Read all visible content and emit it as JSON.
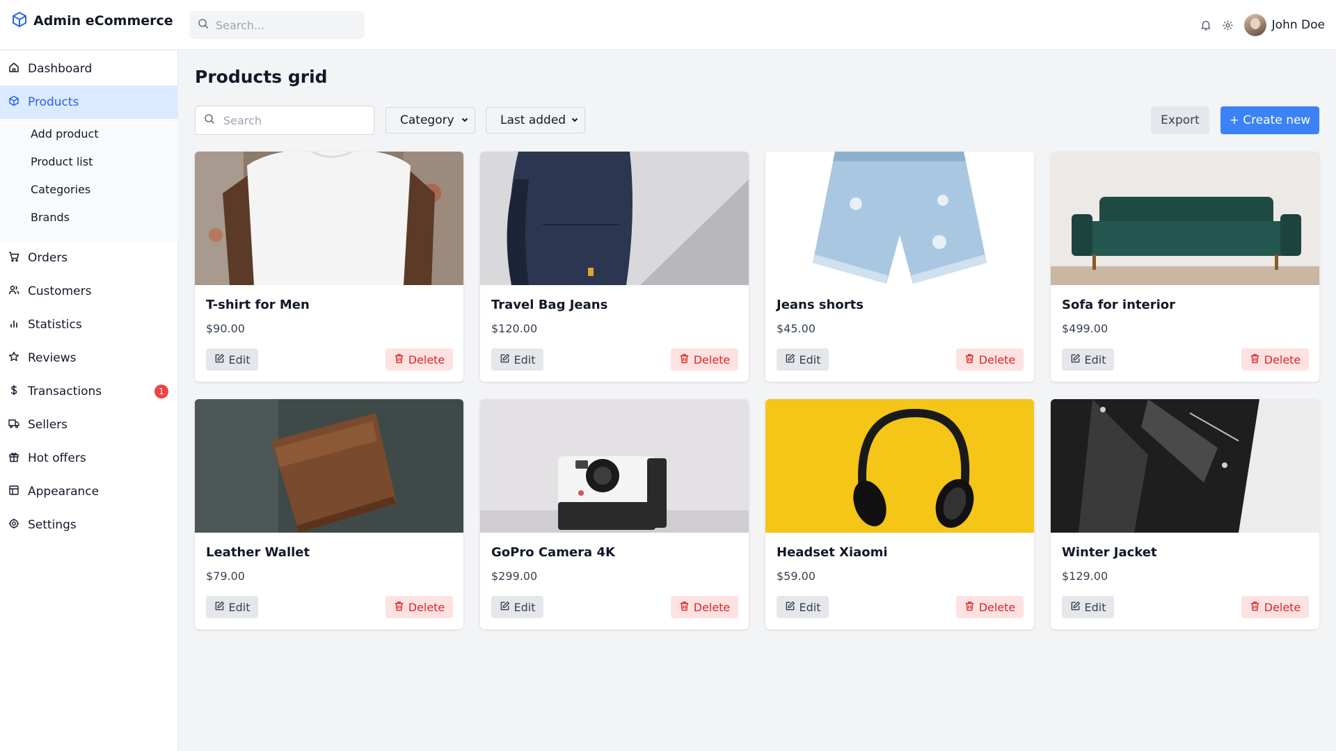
{
  "app": {
    "title": "Admin eCommerce"
  },
  "header": {
    "search_placeholder": "Search...",
    "user_name": "John Doe"
  },
  "sidebar": {
    "items": [
      {
        "label": "Dashboard",
        "icon": "home-icon"
      },
      {
        "label": "Products",
        "icon": "cube-icon",
        "active": true
      },
      {
        "label": "Orders",
        "icon": "cart-icon"
      },
      {
        "label": "Customers",
        "icon": "users-icon"
      },
      {
        "label": "Statistics",
        "icon": "bar-chart-icon"
      },
      {
        "label": "Reviews",
        "icon": "star-icon"
      },
      {
        "label": "Transactions",
        "icon": "dollar-icon",
        "badge": "1"
      },
      {
        "label": "Sellers",
        "icon": "truck-icon"
      },
      {
        "label": "Hot offers",
        "icon": "gift-icon"
      },
      {
        "label": "Appearance",
        "icon": "layout-icon"
      },
      {
        "label": "Settings",
        "icon": "gear-icon"
      }
    ],
    "submenu": [
      "Add product",
      "Product list",
      "Categories",
      "Brands"
    ]
  },
  "main": {
    "title": "Products grid",
    "search_placeholder": "Search",
    "category_select": "Category",
    "sort_select": "Last added",
    "export_label": "Export",
    "create_label": "+ Create new",
    "edit_label": "Edit",
    "delete_label": "Delete",
    "products": [
      {
        "name": "T-shirt for Men",
        "price": "$90.00"
      },
      {
        "name": "Travel Bag Jeans",
        "price": "$120.00"
      },
      {
        "name": "Jeans shorts",
        "price": "$45.00"
      },
      {
        "name": "Sofa for interior",
        "price": "$499.00"
      },
      {
        "name": "Leather Wallet",
        "price": "$79.00"
      },
      {
        "name": "GoPro Camera 4K",
        "price": "$299.00"
      },
      {
        "name": "Headset Xiaomi",
        "price": "$59.00"
      },
      {
        "name": "Winter Jacket",
        "price": "$129.00"
      }
    ]
  },
  "colors": {
    "accent": "#3b82f6",
    "active_bg": "#dbeafe",
    "danger": "#dc2626",
    "danger_bg": "#fee2e2",
    "badge": "#ef4444"
  }
}
